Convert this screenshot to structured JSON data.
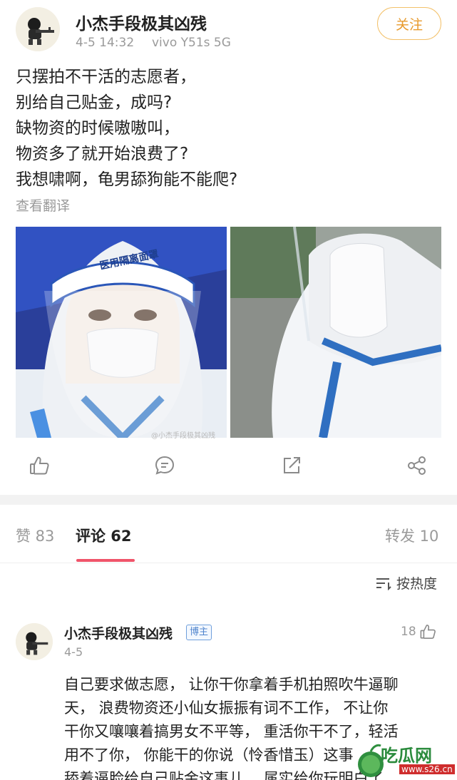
{
  "post": {
    "username": "小杰手段极其凶残",
    "time": "4-5 14:32",
    "device": "vivo Y51s 5G",
    "follow_label": "关注",
    "lines": [
      "只摆拍不干活的志愿者，",
      "别给自己贴金，成吗?",
      "缺物资的时候嗷嗷叫，",
      "物资多了就开始浪费了?",
      "我想啸啊，龟男舔狗能不能爬?"
    ],
    "translate_label": "查看翻译",
    "photo_left_shield_text": "医用隔离面罩",
    "watermark": "@小杰手段极其凶残"
  },
  "tabs": {
    "likes": "赞 83",
    "comments": "评论 62",
    "reposts": "转发 10"
  },
  "sort": {
    "label": "按热度"
  },
  "comment": {
    "username": "小杰手段极其凶残",
    "badge": "博主",
    "date": "4-5",
    "likes": "18",
    "lines": [
      "自己要求做志愿， 让你干你拿着手机拍照吹牛逼聊",
      "天， 浪费物资还小仙女振振有词不工作， 不让你",
      "干你又嚷嚷着搞男女不平等， 重活你干不了，轻活",
      "用不了你， 你能干的你说（怜香惜玉）这事",
      "舔着逼脸给自己贴金这事儿， 属实给你玩明白了"
    ]
  },
  "site_logo": {
    "name": "吃瓜网",
    "url": "www.s26.cn"
  },
  "colors": {
    "accent_pink": "#f0546a",
    "follow_orange": "#e89a2c",
    "badge_blue": "#4f84cc",
    "logo_green": "#2b8b3d"
  },
  "icons": {
    "like": "thumb-up-icon",
    "comment": "comment-bubble-icon",
    "repost": "share-out-icon",
    "share": "share-nodes-icon",
    "sort": "sort-lines-icon"
  }
}
